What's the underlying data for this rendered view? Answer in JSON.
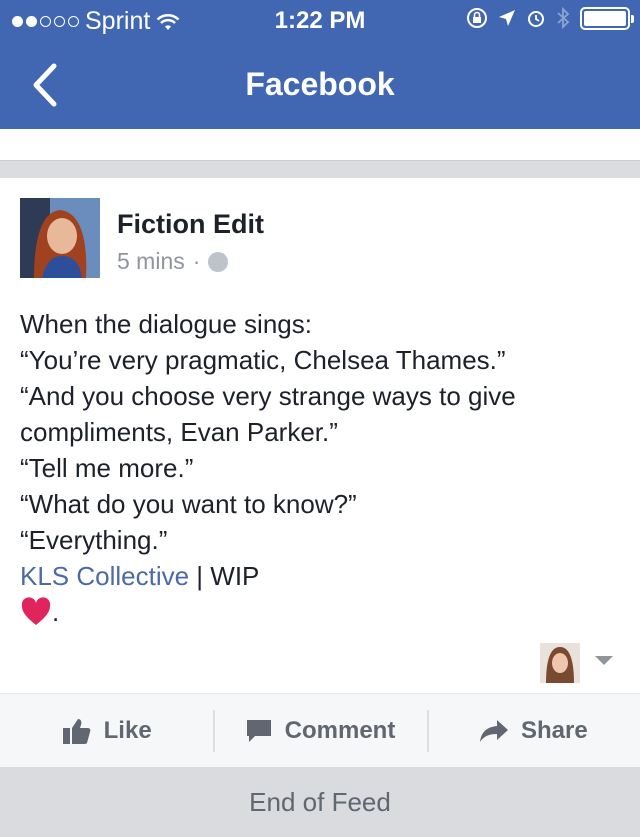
{
  "status_bar": {
    "carrier": "Sprint",
    "time": "1:22 PM",
    "signal_dots_filled": 2,
    "signal_dots_total": 5
  },
  "nav": {
    "title": "Facebook",
    "back_icon": "chevron-left-icon"
  },
  "post": {
    "author": "Fiction Edit",
    "time_ago": "5 mins",
    "separator": "·",
    "privacy_icon": "globe-icon",
    "lines": [
      "When the dialogue sings:",
      "“You’re very pragmatic, Chelsea Thames.”",
      "“And you choose very strange ways to give compliments, Evan Parker.”",
      "“Tell me more.”",
      "“What do you want to know?”",
      "“Everything.”"
    ],
    "link_text": "KLS Collective",
    "after_link": " | WIP",
    "heart_suffix": "."
  },
  "actions": {
    "like": "Like",
    "comment": "Comment",
    "share": "Share"
  },
  "footer": {
    "end_text": "End of Feed"
  },
  "colors": {
    "brand": "#4267b2",
    "link": "#4b6aa8",
    "heart": "#e0245e"
  }
}
